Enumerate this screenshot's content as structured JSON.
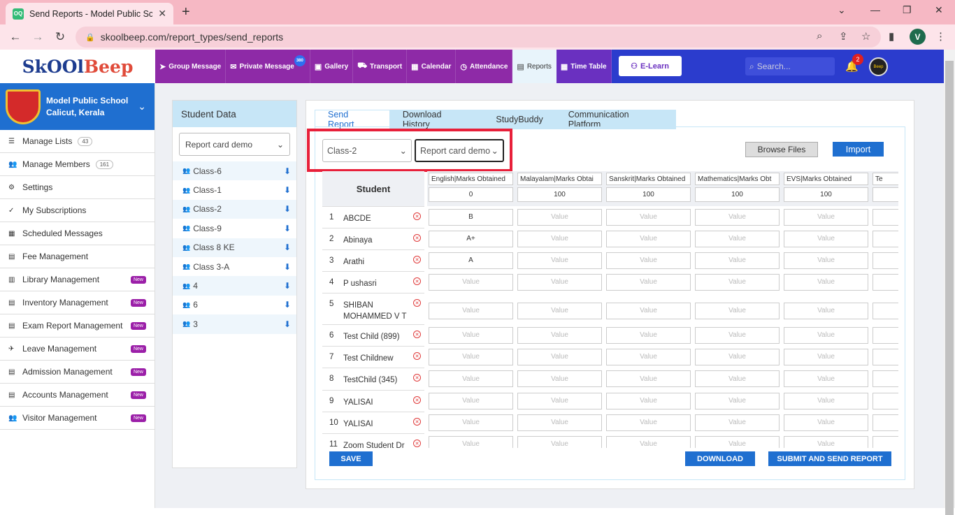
{
  "browser": {
    "tab_title": "Send Reports - Model Public Sch",
    "favicon_text": "OQ",
    "url": "skoolbeep.com/report_types/send_reports",
    "profile_initial": "V"
  },
  "brand": {
    "part1": "SkOOl",
    "part2": "Beep"
  },
  "topnav": {
    "items": [
      {
        "label": "Group Message",
        "icon": "send-icon"
      },
      {
        "label": "Private Message",
        "icon": "mail-icon",
        "badge": "380"
      },
      {
        "label": "Gallery",
        "icon": "image-icon"
      },
      {
        "label": "Transport",
        "icon": "bus-icon"
      },
      {
        "label": "Calendar",
        "icon": "calendar-icon"
      },
      {
        "label": "Attendance",
        "icon": "clock-icon"
      },
      {
        "label": "Reports",
        "icon": "document-icon"
      },
      {
        "label": "Time Table",
        "icon": "timetable-icon"
      }
    ],
    "elearn_label": "E-Learn",
    "search_placeholder": "Search...",
    "notification_count": "2",
    "avatar_text": "Beep"
  },
  "school": {
    "name": "Model Public School",
    "location": "Calicut, Kerala"
  },
  "sidebar": {
    "items": [
      {
        "label": "Manage Lists",
        "icon": "list-icon",
        "count": "43"
      },
      {
        "label": "Manage Members",
        "icon": "users-icon",
        "count": "161"
      },
      {
        "label": "Settings",
        "icon": "gear-icon"
      },
      {
        "label": "My Subscriptions",
        "icon": "check-icon"
      },
      {
        "label": "Scheduled Messages",
        "icon": "calendar-icon"
      },
      {
        "label": "Fee Management",
        "icon": "receipt-icon"
      },
      {
        "label": "Library Management",
        "icon": "book-icon",
        "new": "New"
      },
      {
        "label": "Inventory Management",
        "icon": "inventory-icon",
        "new": "New"
      },
      {
        "label": "Exam Report Management",
        "icon": "report-icon",
        "new": "New"
      },
      {
        "label": "Leave Management",
        "icon": "leave-icon",
        "new": "New"
      },
      {
        "label": "Admission Management",
        "icon": "admission-icon",
        "new": "New"
      },
      {
        "label": "Accounts Management",
        "icon": "accounts-icon",
        "new": "New"
      },
      {
        "label": "Visitor Management",
        "icon": "visitor-icon",
        "new": "New"
      }
    ]
  },
  "student_data": {
    "title": "Student Data",
    "report_select": "Report card demo",
    "classes": [
      "Class-6",
      "Class-1",
      "Class-2",
      "Class-9",
      "Class 8 KE",
      "Class 3-A",
      "4",
      "6",
      "3"
    ]
  },
  "tabs": [
    "Send Report",
    "Download History",
    "StudyBuddy",
    "Communication Platform"
  ],
  "filters": {
    "class": "Class-2",
    "report": "Report card demo"
  },
  "buttons": {
    "browse": "Browse Files",
    "import": "Import",
    "save": "SAVE",
    "download": "DOWNLOAD",
    "submit": "SUBMIT AND SEND REPORT"
  },
  "grid": {
    "student_header": "Student",
    "placeholder": "Value",
    "subjects": [
      {
        "name": "English|Marks Obtained",
        "max": "0"
      },
      {
        "name": "Malayalam|Marks Obtai",
        "max": "100"
      },
      {
        "name": "Sanskrit|Marks Obtained",
        "max": "100"
      },
      {
        "name": "Mathematics|Marks Obt",
        "max": "100"
      },
      {
        "name": "EVS|Marks Obtained",
        "max": "100"
      },
      {
        "name": "Te",
        "max": ""
      }
    ],
    "students": [
      {
        "num": "1",
        "name": "ABCDE",
        "values": [
          "B",
          "",
          "",
          "",
          "",
          ""
        ]
      },
      {
        "num": "2",
        "name": "Abinaya",
        "values": [
          "A+",
          "",
          "",
          "",
          "",
          ""
        ]
      },
      {
        "num": "3",
        "name": "Arathi",
        "values": [
          "A",
          "",
          "",
          "",
          "",
          ""
        ]
      },
      {
        "num": "4",
        "name": "P ushasri",
        "values": [
          "",
          "",
          "",
          "",
          "",
          ""
        ]
      },
      {
        "num": "5",
        "name": "SHIBAN MOHAMMED V T",
        "values": [
          "",
          "",
          "",
          "",
          "",
          ""
        ]
      },
      {
        "num": "6",
        "name": "Test Child (899)",
        "values": [
          "",
          "",
          "",
          "",
          "",
          ""
        ]
      },
      {
        "num": "7",
        "name": "Test Childnew",
        "values": [
          "",
          "",
          "",
          "",
          "",
          ""
        ]
      },
      {
        "num": "8",
        "name": "TestChild (345)",
        "values": [
          "",
          "",
          "",
          "",
          "",
          ""
        ]
      },
      {
        "num": "9",
        "name": "YALISAI",
        "values": [
          "",
          "",
          "",
          "",
          "",
          ""
        ]
      },
      {
        "num": "10",
        "name": "YALISAI",
        "values": [
          "",
          "",
          "",
          "",
          "",
          ""
        ]
      },
      {
        "num": "11",
        "name": "Zoom Student Dr",
        "values": [
          "",
          "",
          "",
          "",
          "",
          ""
        ]
      }
    ]
  }
}
